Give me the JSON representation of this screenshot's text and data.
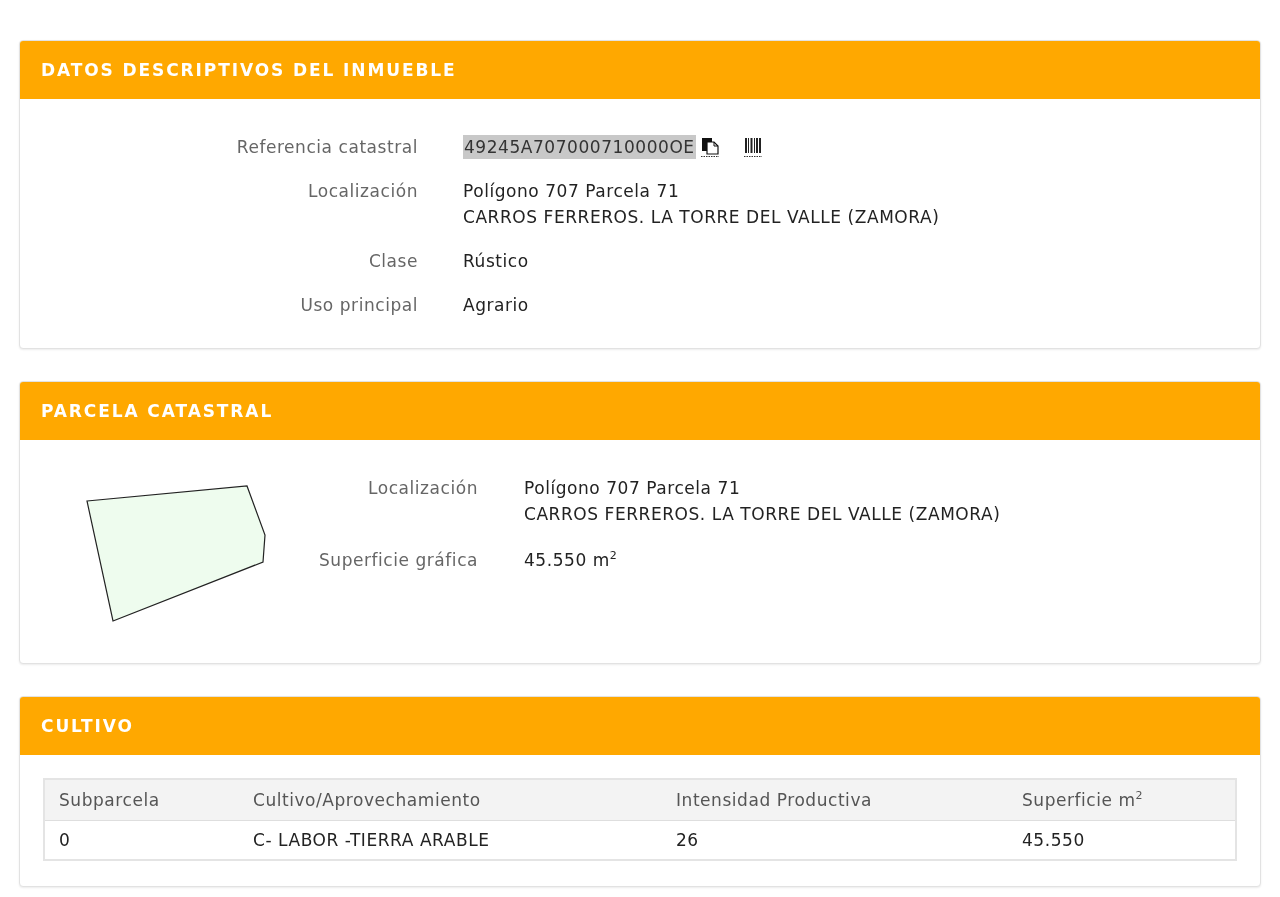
{
  "property_panel": {
    "title": "DATOS DESCRIPTIVOS DEL INMUEBLE",
    "reference": {
      "label": "Referencia catastral",
      "value": "49245A707000710000OE",
      "highlighted": true
    },
    "fields": [
      {
        "label": "Localización",
        "lines": [
          "Polígono 707 Parcela 71",
          "CARROS FERREROS. LA TORRE DEL VALLE (ZAMORA)"
        ]
      },
      {
        "label": "Clase",
        "lines": [
          "Rústico"
        ]
      },
      {
        "label": "Uso principal",
        "lines": [
          "Agrario"
        ]
      }
    ]
  },
  "parcel_panel": {
    "title": "PARCELA CATASTRAL",
    "fields": [
      {
        "label": "Localización",
        "lines": [
          "Polígono 707 Parcela 71",
          "CARROS FERREROS. LA TORRE DEL VALLE (ZAMORA)"
        ]
      },
      {
        "label": "Superficie gráfica",
        "lines": [
          "45.550 m$^{2}$"
        ]
      }
    ]
  },
  "crop_panel": {
    "title": "CULTIVO",
    "table": {
      "columns": [
        "Subparcela",
        "Cultivo/Aprovechamiento",
        "Intensidad Productiva",
        "Superficie m$^{2}$"
      ],
      "rows": [
        [
          "0",
          "C- LABOR -TIERRA ARABLE",
          "26",
          "45.550"
        ]
      ]
    }
  }
}
